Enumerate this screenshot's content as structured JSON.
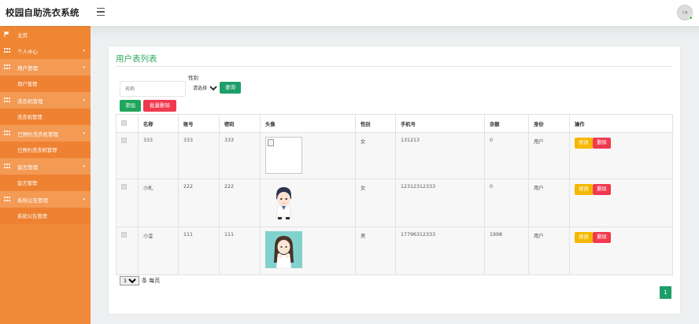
{
  "header": {
    "brand": "校园自助洗衣系统",
    "avatar_text": "头像"
  },
  "sidebar": {
    "items": [
      {
        "label": "主页",
        "type": "top"
      },
      {
        "label": "个人中心",
        "type": "top",
        "arrow": true
      },
      {
        "label": "用户管理",
        "type": "parent",
        "arrow": true
      },
      {
        "label": "用户管理",
        "type": "sub"
      },
      {
        "label": "洗衣机管理",
        "type": "parent",
        "arrow": true
      },
      {
        "label": "洗衣机管理",
        "type": "sub"
      },
      {
        "label": "已预约洗衣机管理",
        "type": "parent",
        "arrow": true
      },
      {
        "label": "已预约洗衣机管理",
        "type": "sub"
      },
      {
        "label": "留言管理",
        "type": "parent",
        "arrow": true
      },
      {
        "label": "留言管理",
        "type": "sub"
      },
      {
        "label": "系统公告管理",
        "type": "parent",
        "arrow": true
      },
      {
        "label": "系统公告管理",
        "type": "sub"
      }
    ]
  },
  "main": {
    "title": "用户表列表",
    "search": {
      "name_placeholder": "名称",
      "gender_label": "性别",
      "gender_selected": "请选择",
      "search_button": "查询"
    },
    "add_button": "添加",
    "batch_delete_button": "批量删除",
    "table": {
      "headers": [
        "名称",
        "账号",
        "密码",
        "头像",
        "性别",
        "手机号",
        "余额",
        "身份",
        "操作"
      ],
      "rows": [
        {
          "name": "333",
          "account": "333",
          "password": "333",
          "avatar": "broken",
          "gender": "女",
          "phone": "131213",
          "balance": "0",
          "role": "用户"
        },
        {
          "name": "小札",
          "account": "222",
          "password": "222",
          "avatar": "boy",
          "gender": "女",
          "phone": "12312312333",
          "balance": "0",
          "role": "用户"
        },
        {
          "name": "小金",
          "account": "111",
          "password": "111",
          "avatar": "girl",
          "gender": "男",
          "phone": "17796312333",
          "balance": "1998",
          "role": "用户"
        }
      ],
      "edit_label": "修改",
      "delete_label": "删除"
    },
    "pagination": {
      "per_page_value": "10",
      "per_page_suffix": "条 每页",
      "current_page": "1"
    }
  },
  "colors": {
    "sidebar": "#f0893a",
    "accent_green": "#2eaa61",
    "danger": "#f0394f",
    "warning": "#f5b800"
  }
}
